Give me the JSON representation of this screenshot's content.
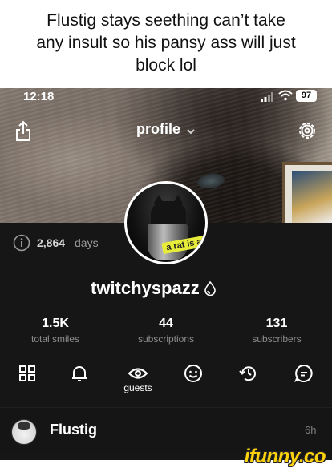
{
  "caption": {
    "line1": "Flustig stays seething can’t take",
    "line2": "any insult so his pansy ass will just",
    "line3": "block lol"
  },
  "status_bar": {
    "time": "12:18",
    "battery": "97"
  },
  "header": {
    "title": "profile",
    "dropdown_icon": "chevron-down-icon",
    "share_icon": "share-icon",
    "settings_icon": "gear-icon"
  },
  "profile": {
    "age_icon": "info-icon",
    "age_count": "2,864",
    "age_unit": "days",
    "avatar_sticker": "a rat is a rat",
    "username": "twitchyspazz",
    "verified_icon": "drop-badge-icon"
  },
  "stats": [
    {
      "value": "1.5K",
      "label": "total smiles"
    },
    {
      "value": "44",
      "label": "subscriptions"
    },
    {
      "value": "131",
      "label": "subscribers"
    }
  ],
  "tabs": [
    {
      "icon": "grid-icon",
      "label": ""
    },
    {
      "icon": "bell-icon",
      "label": ""
    },
    {
      "icon": "eye-icon",
      "label": "guests"
    },
    {
      "icon": "smile-icon",
      "label": ""
    },
    {
      "icon": "history-icon",
      "label": ""
    },
    {
      "icon": "chat-icon",
      "label": ""
    }
  ],
  "post": {
    "author": "Flustig",
    "time": "6h"
  },
  "watermark": "ifunny.co",
  "colors": {
    "background": "#161616",
    "accent_yellow": "#ffd30c",
    "muted_text": "#8d8d8d"
  }
}
